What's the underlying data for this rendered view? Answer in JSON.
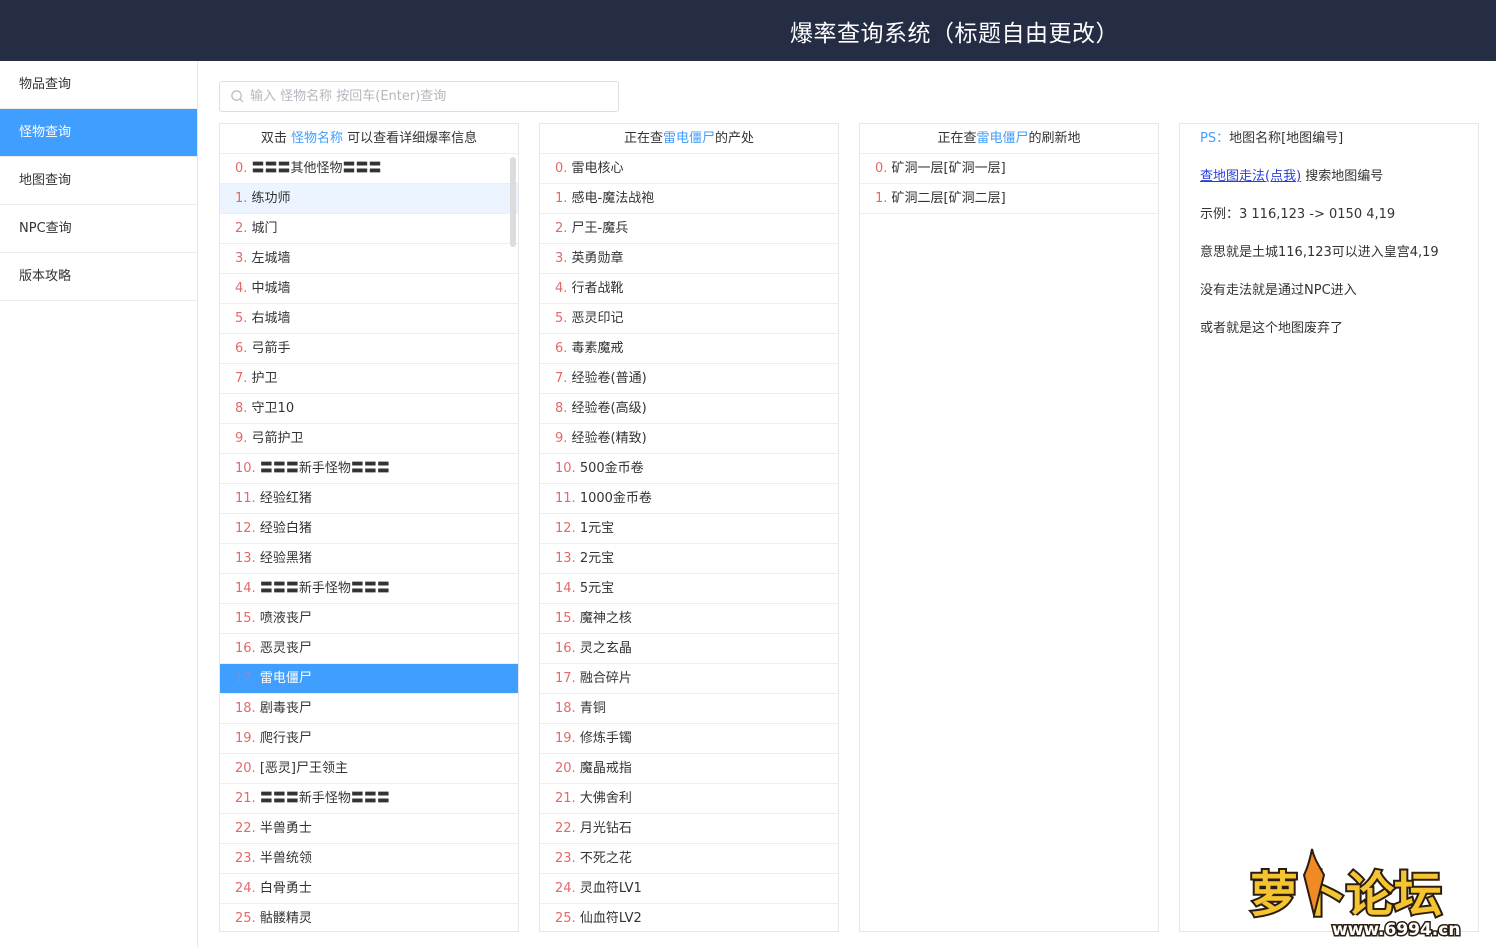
{
  "header": {
    "title": "爆率查询系统（标题自由更改）"
  },
  "sidebar": {
    "items": [
      {
        "label": "物品查询"
      },
      {
        "label": "怪物查询"
      },
      {
        "label": "地图查询"
      },
      {
        "label": "NPC查询"
      },
      {
        "label": "版本攻略"
      }
    ],
    "active_index": 1
  },
  "search": {
    "placeholder": "输入 怪物名称 按回车(Enter)查询",
    "value": ""
  },
  "monster_panel": {
    "head_pre": "双击 ",
    "head_hl": "怪物名称",
    "head_post": " 可以查看详细爆率信息",
    "selected_index": 17,
    "hover_index": 1,
    "items": [
      "〓〓〓其他怪物〓〓〓",
      "练功师",
      "城门",
      "左城墙",
      "中城墙",
      "右城墙",
      "弓箭手",
      "护卫",
      "守卫10",
      "弓箭护卫",
      "〓〓〓新手怪物〓〓〓",
      "经验红猪",
      "经验白猪",
      "经验黑猪",
      "〓〓〓新手怪物〓〓〓",
      "喷液丧尸",
      "恶灵丧尸",
      "雷电僵尸",
      "剧毒丧尸",
      "爬行丧尸",
      "[恶灵]尸王领主",
      "〓〓〓新手怪物〓〓〓",
      "半兽勇士",
      "半兽统领",
      "白骨勇士",
      "骷髅精灵"
    ]
  },
  "drops_panel": {
    "head_pre": "正在查",
    "head_hl": "雷电僵尸",
    "head_post": "的产处",
    "items": [
      "雷电核心",
      "感电-魔法战袍",
      "尸王-魔兵",
      "英勇勋章",
      "行者战靴",
      "恶灵印记",
      "毒素魔戒",
      "经验卷(普通)",
      "经验卷(高级)",
      "经验卷(精致)",
      "500金币卷",
      "1000金币卷",
      "1元宝",
      "2元宝",
      "5元宝",
      "魔神之核",
      "灵之玄晶",
      "融合碎片",
      "青铜",
      "修炼手镯",
      "魔晶戒指",
      "大佛舍利",
      "月光钻石",
      "不死之花",
      "灵血符LV1",
      "仙血符LV2"
    ]
  },
  "spawn_panel": {
    "head_pre": "正在查",
    "head_hl": "雷电僵尸",
    "head_post": "的刷新地",
    "items": [
      "矿洞一层[矿洞一层]",
      "矿洞二层[矿洞二层]"
    ]
  },
  "info_panel": {
    "ps_label": "PS：",
    "ps_text": "地图名称[地图编号]",
    "link_text": "查地图走法(点我)",
    "link_after": " 搜索地图编号",
    "lines": [
      "示例：3 116,123 -> 0150 4,19",
      "意思就是土城116,123可以进入皇宫4,19",
      "没有走法就是通过NPC进入",
      "或者就是这个地图废弃了"
    ]
  },
  "watermark": {
    "brand": "萝卜论坛",
    "url": "www.6994.cn"
  },
  "colors": {
    "header_bg": "#252d45",
    "accent": "#409eff",
    "index_red": "#e26a6a",
    "link": "#2a3fe0"
  }
}
